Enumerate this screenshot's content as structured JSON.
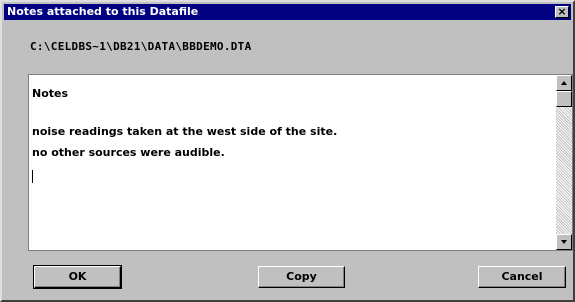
{
  "window": {
    "title": "Notes attached to this Datafile",
    "close_label": "×"
  },
  "file_path": "C:\\CELDBS~1\\DB21\\DATA\\BBDEMO.DTA",
  "notes": {
    "lines": [
      "Notes",
      "noise readings taken at the west side of the site.",
      "no other sources were audible."
    ]
  },
  "buttons": {
    "ok": "OK",
    "copy": "Copy",
    "cancel": "Cancel"
  },
  "colors": {
    "titlebar": "#000080",
    "face": "#c0c0c0"
  }
}
